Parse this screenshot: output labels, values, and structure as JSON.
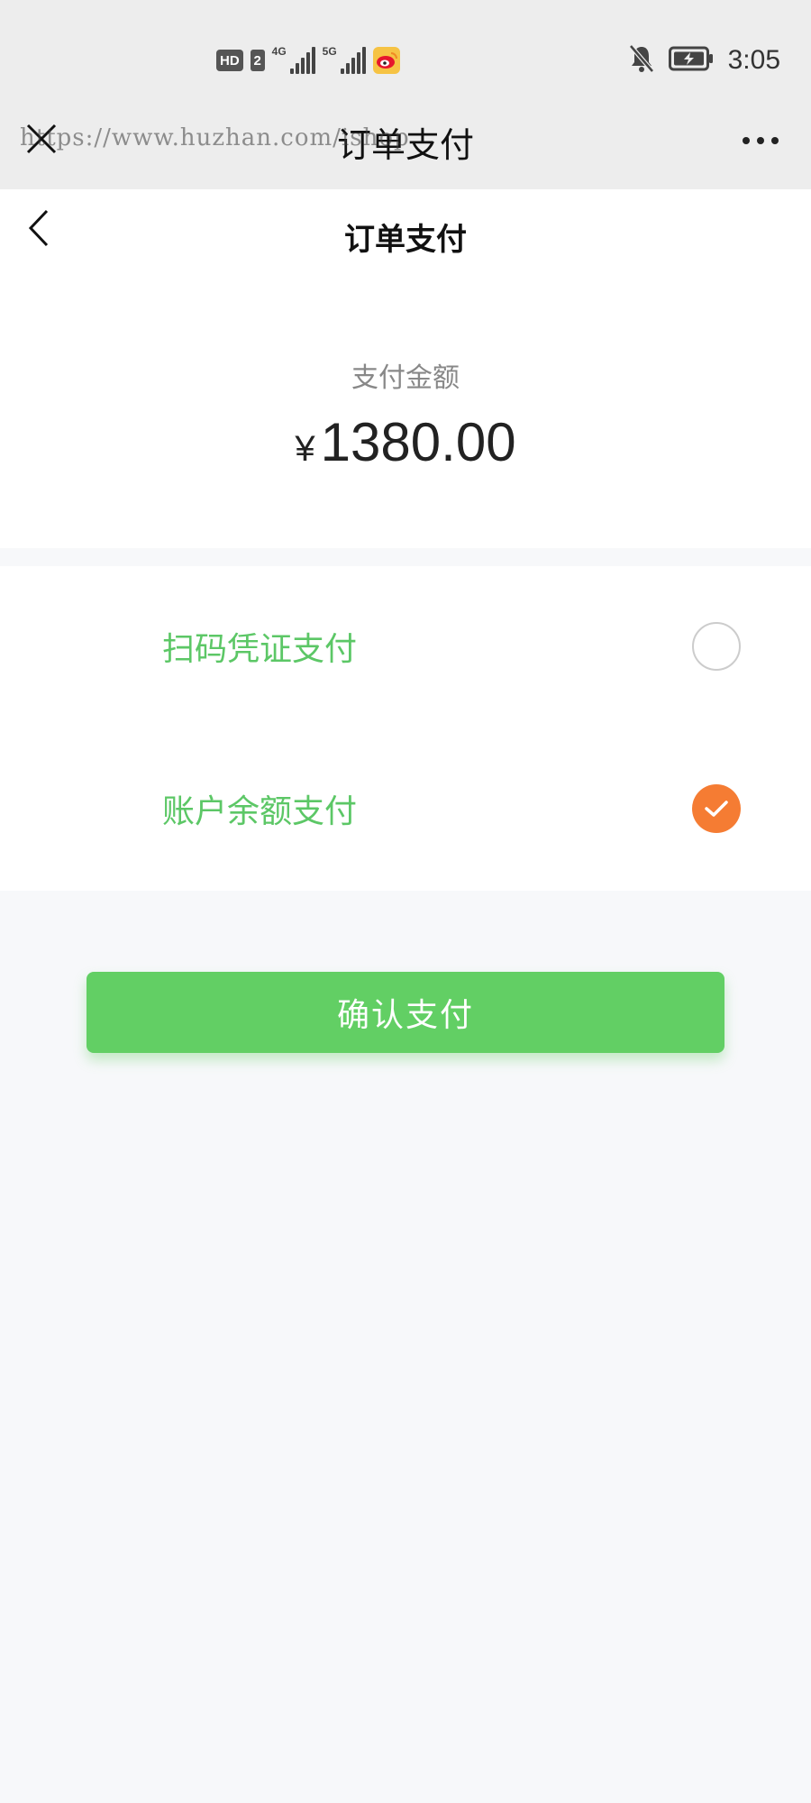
{
  "status_bar": {
    "hd_label": "HD",
    "sim_label": "2",
    "net1": "4G",
    "net2": "5G",
    "time": "3:05"
  },
  "wechat_header": {
    "title": "订单支付",
    "watermark": "https://www.huzhan.com/ishop"
  },
  "page": {
    "title": "订单支付"
  },
  "amount": {
    "label": "支付金额",
    "currency": "¥",
    "value": "1380.00"
  },
  "methods": [
    {
      "label": "扫码凭证支付",
      "selected": false
    },
    {
      "label": "账户余额支付",
      "selected": true
    }
  ],
  "confirm": {
    "label": "确认支付"
  },
  "colors": {
    "accent_green": "#62cf64",
    "label_green": "#5cc766",
    "selected_orange": "#f57c33",
    "header_bg": "#ededed",
    "page_bg": "#f7f8fa"
  }
}
